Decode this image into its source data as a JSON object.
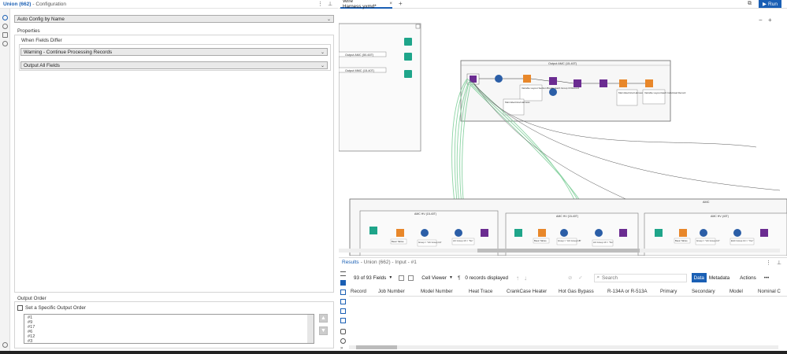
{
  "config": {
    "title": "Union (662)",
    "subtitle": "- Configuration",
    "mode_select": "Auto Config by Name",
    "properties_label": "Properties",
    "when_fields_differ_label": "When Fields Differ",
    "differ_select": "Warning - Continue Processing Records",
    "output_select": "Output All Fields",
    "output_order_label": "Output Order",
    "specific_order_label": "Set a Specific Output Order",
    "order_items": [
      "#1",
      "#9",
      "#17",
      "#6",
      "#12",
      "#3"
    ]
  },
  "tabs": {
    "active": "Wire Harness.yxmd*",
    "add": "+"
  },
  "run_label": "Run",
  "canvas": {
    "container_top_left_labels": [
      "Output AMC (50-60T)",
      "Output MMC (15-40T)"
    ],
    "container_main_title": "Output AMC (15-40T)",
    "main_notes": [
      "Variable Layout Section Breaks Each Group Of Record",
      "Main Electrical Harness",
      "Main Electrical Harness",
      "Variable Layout Each Individual Record"
    ],
    "bottom_container_title": "AMC",
    "sub_containers": [
      "AMC HV (15-40T)",
      "AMC HV (15-40T)",
      "AMC HV (40T)"
    ],
    "small_labels": [
      "Basic Tables",
      "Group = \"AC Group 1A\"",
      "AC Group 1X = \"No\"",
      "Basic Tables",
      "Group = \"AC Group 1B\"",
      "AC Group 1X = \"No\"",
      "Basic Tables",
      "Group = \"AC Group 1C\"",
      "EAC Group 1C = \"Yes\""
    ]
  },
  "results": {
    "title": "Results",
    "subtitle": "- Union (662) - Input - #1",
    "fields_count": "93 of 93 Fields",
    "cell_viewer": "Cell Viewer",
    "records_displayed": "0 records displayed",
    "search_placeholder": "Search",
    "data_tab": "Data",
    "metadata_tab": "Metadata",
    "actions": "Actions",
    "columns": [
      "Record",
      "Job Number",
      "Model Number",
      "Heat Trace",
      "CrankCase Heater",
      "Hot Gas Bypass",
      "R-134A or R-513A",
      "Primary",
      "Secondary",
      "Model",
      "Nominal C"
    ]
  },
  "colors": {
    "accent": "#1a5fb4",
    "tool_teal": "#1fa58a",
    "tool_orange": "#e8872a",
    "tool_purple": "#6b2c91",
    "tool_blue": "#2b5ea7",
    "connection_green": "#7fcf9a"
  }
}
